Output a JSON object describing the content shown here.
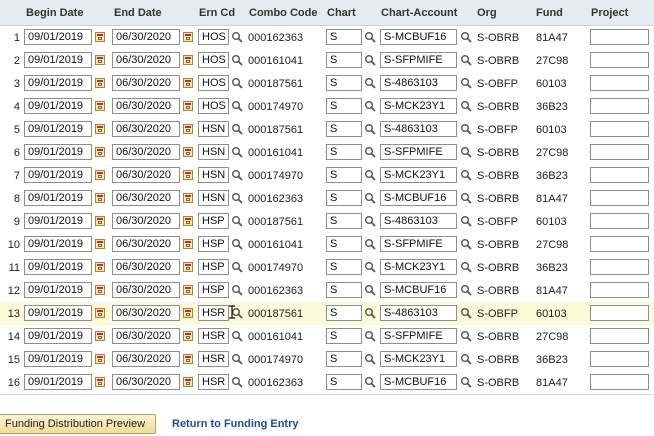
{
  "headers": {
    "begin_date": "Begin Date",
    "end_date": "End Date",
    "ern_cd": "Ern Cd",
    "combo_code": "Combo Code",
    "chart": "Chart",
    "chart_account": "Chart-Account",
    "org": "Org",
    "fund": "Fund",
    "project": "Project"
  },
  "rows": [
    {
      "n": "1",
      "begin": "09/01/2019",
      "end": "06/30/2020",
      "ern": "HOS",
      "combo": "000162363",
      "chart": "S",
      "account": "S-MCBUF16",
      "org": "S-OBRB",
      "fund": "81A47",
      "project": ""
    },
    {
      "n": "2",
      "begin": "09/01/2019",
      "end": "06/30/2020",
      "ern": "HOS",
      "combo": "000161041",
      "chart": "S",
      "account": "S-SFPMIFE",
      "org": "S-OBRB",
      "fund": "27C98",
      "project": ""
    },
    {
      "n": "3",
      "begin": "09/01/2019",
      "end": "06/30/2020",
      "ern": "HOS",
      "combo": "000187561",
      "chart": "S",
      "account": "S-4863103",
      "org": "S-OBFP",
      "fund": "60103",
      "project": ""
    },
    {
      "n": "4",
      "begin": "09/01/2019",
      "end": "06/30/2020",
      "ern": "HOS",
      "combo": "000174970",
      "chart": "S",
      "account": "S-MCK23Y1",
      "org": "S-OBRB",
      "fund": "36B23",
      "project": ""
    },
    {
      "n": "5",
      "begin": "09/01/2019",
      "end": "06/30/2020",
      "ern": "HSN",
      "combo": "000187561",
      "chart": "S",
      "account": "S-4863103",
      "org": "S-OBFP",
      "fund": "60103",
      "project": ""
    },
    {
      "n": "6",
      "begin": "09/01/2019",
      "end": "06/30/2020",
      "ern": "HSN",
      "combo": "000161041",
      "chart": "S",
      "account": "S-SFPMIFE",
      "org": "S-OBRB",
      "fund": "27C98",
      "project": ""
    },
    {
      "n": "7",
      "begin": "09/01/2019",
      "end": "06/30/2020",
      "ern": "HSN",
      "combo": "000174970",
      "chart": "S",
      "account": "S-MCK23Y1",
      "org": "S-OBRB",
      "fund": "36B23",
      "project": ""
    },
    {
      "n": "8",
      "begin": "09/01/2019",
      "end": "06/30/2020",
      "ern": "HSN",
      "combo": "000162363",
      "chart": "S",
      "account": "S-MCBUF16",
      "org": "S-OBRB",
      "fund": "81A47",
      "project": ""
    },
    {
      "n": "9",
      "begin": "09/01/2019",
      "end": "06/30/2020",
      "ern": "HSP",
      "combo": "000187561",
      "chart": "S",
      "account": "S-4863103",
      "org": "S-OBFP",
      "fund": "60103",
      "project": ""
    },
    {
      "n": "10",
      "begin": "09/01/2019",
      "end": "06/30/2020",
      "ern": "HSP",
      "combo": "000161041",
      "chart": "S",
      "account": "S-SFPMIFE",
      "org": "S-OBRB",
      "fund": "27C98",
      "project": ""
    },
    {
      "n": "11",
      "begin": "09/01/2019",
      "end": "06/30/2020",
      "ern": "HSP",
      "combo": "000174970",
      "chart": "S",
      "account": "S-MCK23Y1",
      "org": "S-OBRB",
      "fund": "36B23",
      "project": ""
    },
    {
      "n": "12",
      "begin": "09/01/2019",
      "end": "06/30/2020",
      "ern": "HSP",
      "combo": "000162363",
      "chart": "S",
      "account": "S-MCBUF16",
      "org": "S-OBRB",
      "fund": "81A47",
      "project": ""
    },
    {
      "n": "13",
      "begin": "09/01/2019",
      "end": "06/30/2020",
      "ern": "HSR",
      "combo": "000187561",
      "chart": "S",
      "account": "S-4863103",
      "org": "S-OBFP",
      "fund": "60103",
      "project": ""
    },
    {
      "n": "14",
      "begin": "09/01/2019",
      "end": "06/30/2020",
      "ern": "HSR",
      "combo": "000161041",
      "chart": "S",
      "account": "S-SFPMIFE",
      "org": "S-OBRB",
      "fund": "27C98",
      "project": ""
    },
    {
      "n": "15",
      "begin": "09/01/2019",
      "end": "06/30/2020",
      "ern": "HSR",
      "combo": "000174970",
      "chart": "S",
      "account": "S-MCK23Y1",
      "org": "S-OBRB",
      "fund": "36B23",
      "project": ""
    },
    {
      "n": "16",
      "begin": "09/01/2019",
      "end": "06/30/2020",
      "ern": "HSR",
      "combo": "000162363",
      "chart": "S",
      "account": "S-MCBUF16",
      "org": "S-OBRB",
      "fund": "81A47",
      "project": ""
    }
  ],
  "highlighted_row": "13",
  "footer": {
    "preview_button": "Funding Distribution Preview",
    "return_link": "Return to Funding Entry"
  },
  "colors": {
    "header_bg": "#e6ebf1",
    "highlight_bg": "#fbfbd9",
    "link": "#1c4fa0",
    "button_bg": "#f0dd98"
  },
  "icons": {
    "calendar": "calendar-icon",
    "lookup": "magnifier-icon"
  }
}
